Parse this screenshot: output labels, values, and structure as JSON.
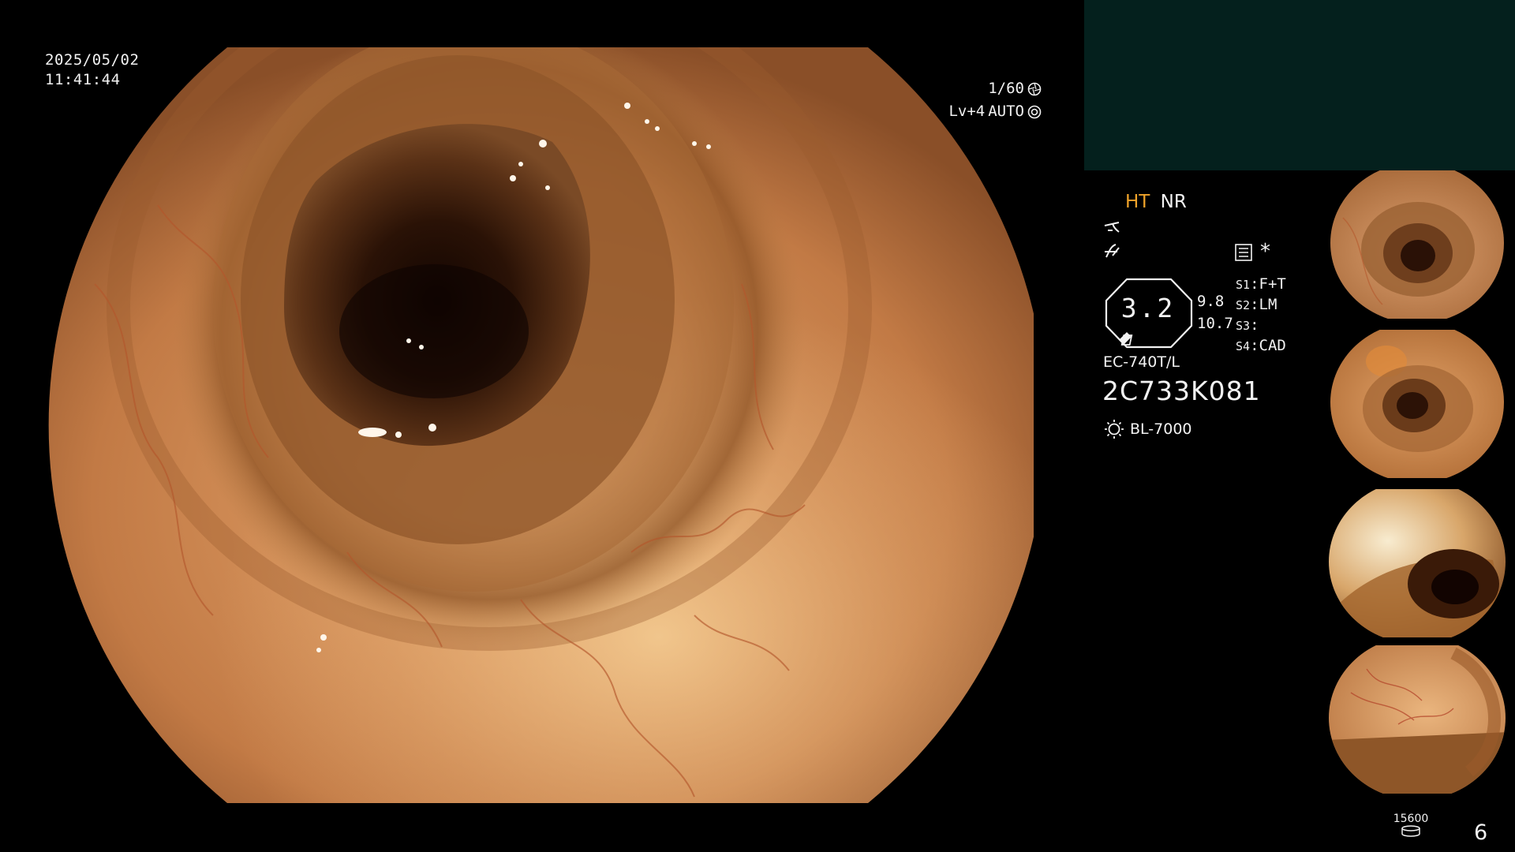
{
  "overlay": {
    "date": "2025/05/02",
    "time": "11:41:44",
    "shutter": "1/60",
    "level": "Lv+4",
    "iris_mode": "AUTO"
  },
  "panel": {
    "mode_ht": "HT",
    "mode_nr": "NR",
    "zoom": "3.2",
    "param_1": "9.8",
    "param_2": "10.7",
    "switches": [
      {
        "key": "S1",
        "value": "F+T"
      },
      {
        "key": "S2",
        "value": "LM"
      },
      {
        "key": "S3",
        "value": ""
      },
      {
        "key": "S4",
        "value": "CAD"
      }
    ],
    "star": "*",
    "scope_model": "EC-740T/L",
    "scope_serial": "2C733K081",
    "light_source": "BL-7000"
  },
  "footer": {
    "storage_count": "15600",
    "frame_count": "6"
  },
  "icons": {
    "shutter": "aperture-icon",
    "iris": "iris-icon",
    "enhance_1": "structure-enhance-icon",
    "enhance_2": "color-enhance-icon",
    "menu": "menu-list-icon",
    "light": "light-source-icon",
    "storage": "storage-disk-icon"
  },
  "colors": {
    "background": "#000000",
    "text": "#f2f2f2",
    "mode_highlight": "#f0a32a",
    "panel_block": "#04201d"
  }
}
